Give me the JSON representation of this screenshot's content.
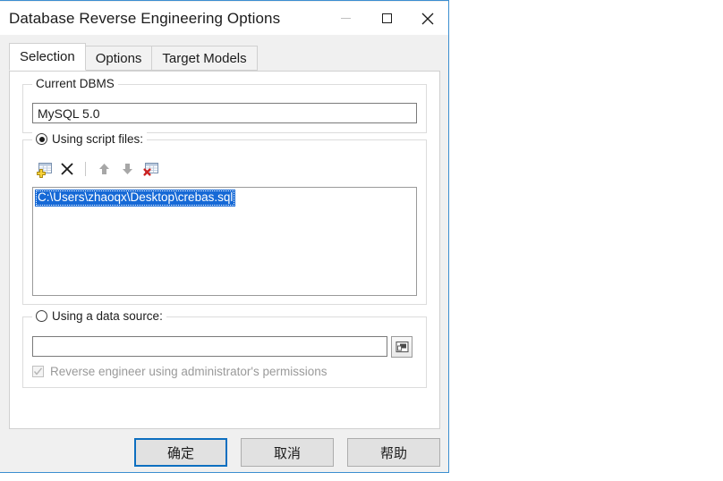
{
  "window": {
    "title": "Database Reverse Engineering Options",
    "controls": {
      "minimize": "minimize-icon",
      "maximize": "maximize-icon",
      "close": "close-icon"
    }
  },
  "tabs": [
    {
      "label": "Selection",
      "active": true
    },
    {
      "label": "Options",
      "active": false
    },
    {
      "label": "Target Models",
      "active": false
    }
  ],
  "groups": {
    "dbms": {
      "legend": "Current DBMS",
      "value": "MySQL 5.0"
    },
    "script_files": {
      "legend": "Using script files:",
      "radio_selected": true,
      "toolbar": [
        {
          "name": "add-script-file-icon",
          "title": "Add script file",
          "enabled": true
        },
        {
          "name": "delete-icon",
          "title": "Delete",
          "enabled": true
        },
        {
          "name": "move-up-icon",
          "title": "Move up",
          "enabled": false
        },
        {
          "name": "move-down-icon",
          "title": "Move down",
          "enabled": false
        },
        {
          "name": "remove-all-icon",
          "title": "Remove all",
          "enabled": true
        }
      ],
      "items": [
        {
          "path": "C:\\Users\\zhaoqx\\Desktop\\crebas.sql",
          "selected": true
        }
      ]
    },
    "data_source": {
      "legend": "Using a data source:",
      "radio_selected": false,
      "value": "",
      "browse_icon": "database-browse-icon",
      "checkbox": {
        "label": "Reverse engineer using administrator's permissions",
        "checked": true,
        "enabled": false
      }
    }
  },
  "buttons": {
    "ok": "确定",
    "cancel": "取消",
    "help": "帮助"
  },
  "colors": {
    "accent": "#0d6fc0",
    "selection": "#1669d6",
    "window_border": "#3b8ed0",
    "dialog_bg": "#f0f0f0"
  }
}
